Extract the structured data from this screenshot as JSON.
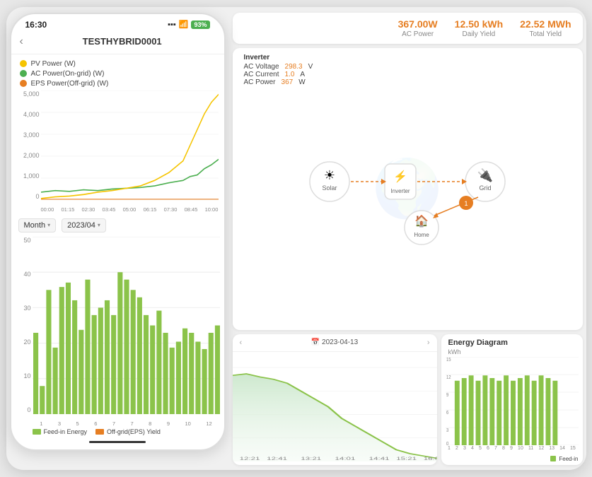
{
  "phone": {
    "status": {
      "time": "16:30",
      "signal": "▪▪▪",
      "wifi": "WiFi",
      "battery": "93%"
    },
    "header": {
      "back": "‹",
      "title": "TESTHYBRID0001"
    },
    "legend": [
      {
        "label": "PV Power (W)",
        "color": "#f5c400"
      },
      {
        "label": "AC Power(On-grid) (W)",
        "color": "#4caf50"
      },
      {
        "label": "EPS Power(Off-grid) (W)",
        "color": "#e67e22"
      }
    ],
    "lineChart": {
      "yLabels": [
        "5,000",
        "4,000",
        "3,000",
        "2,000",
        "1,000",
        "0"
      ],
      "xLabels": [
        "00:00",
        "01:15",
        "02:30",
        "03:45",
        "05:00",
        "06:15",
        "07:30",
        "08:45",
        "10:00"
      ]
    },
    "timeSelector": {
      "period": "Month",
      "date": "2023/04"
    },
    "barChart": {
      "yLabels": [
        "50",
        "40",
        "30",
        "20",
        "10",
        "0"
      ],
      "xLabels": [
        "1",
        "3",
        "5",
        "6",
        "7",
        "7",
        "8",
        "9",
        "10",
        "12"
      ],
      "bars": [
        23,
        8,
        35,
        19,
        36,
        37,
        32,
        24,
        38,
        28,
        30,
        32,
        28,
        40,
        38,
        35,
        33,
        28,
        26,
        30,
        22,
        18,
        20,
        24,
        22,
        20,
        18,
        22,
        26,
        28
      ],
      "legend": [
        {
          "label": "Feed-in Energy",
          "color": "#8bc34a"
        },
        {
          "label": "Off-grid(EPS) Yield",
          "color": "#e67e22"
        }
      ]
    }
  },
  "rightPanel": {
    "stats": [
      {
        "value": "367.00W",
        "label": "AC Power"
      },
      {
        "value": "12.50 kWh",
        "label": "Daily Yield"
      },
      {
        "value": "22.52 MWh",
        "label": "Total Yield"
      }
    ],
    "inverter": {
      "title": "Inverter",
      "rows": [
        {
          "label": "AC Voltage",
          "value": "298.3",
          "unit": "V"
        },
        {
          "label": "AC Current",
          "value": "1.0",
          "unit": "A"
        },
        {
          "label": "AC Power",
          "value": "367",
          "unit": "W"
        }
      ]
    },
    "dailyCard": {
      "date": "2023-04-13",
      "nav": {
        "prev": "‹",
        "next": "›"
      }
    },
    "energyCard": {
      "title": "Energy Diagram",
      "unit": "kWh",
      "yLabels": [
        "15",
        "12",
        "9",
        "6",
        "3",
        "0"
      ],
      "xLabels": [
        "1",
        "2",
        "3",
        "4",
        "5",
        "6",
        "7",
        "8",
        "9",
        "10",
        "11",
        "12",
        "13",
        "14",
        "15"
      ],
      "bars": [
        11,
        11.5,
        12,
        11,
        12,
        11.5,
        11,
        12,
        11,
        11.5,
        12,
        11,
        12,
        11.5,
        11
      ],
      "legendLabel": "●"
    }
  }
}
